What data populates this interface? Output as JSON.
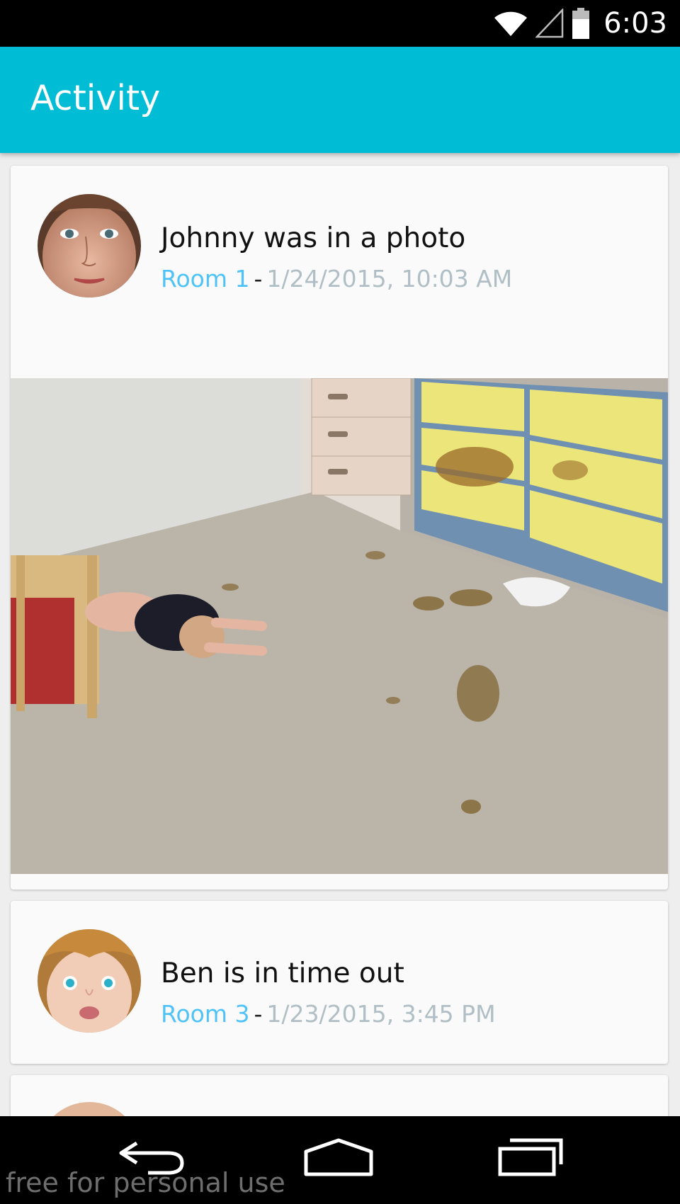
{
  "status_bar": {
    "time": "6:03",
    "icons": [
      "wifi-icon",
      "cell-signal-icon",
      "battery-icon"
    ]
  },
  "app_bar": {
    "title": "Activity",
    "color": "#00bcd4"
  },
  "feed": [
    {
      "title": "Johnny was in a photo",
      "room": "Room 1",
      "separator": "-",
      "timestamp": "1/24/2015, 10:03 AM",
      "has_photo": true
    },
    {
      "title": "Ben is in time out",
      "room": "Room 3",
      "separator": "-",
      "timestamp": "1/23/2015, 3:45 PM",
      "has_photo": false
    }
  ],
  "nav_bar": {
    "buttons": [
      "back-icon",
      "home-icon",
      "recents-icon"
    ]
  },
  "watermark": "free for personal use",
  "colors": {
    "accent": "#00bcd4",
    "room_link": "#4fc3f7",
    "timestamp": "#b0bec5"
  }
}
